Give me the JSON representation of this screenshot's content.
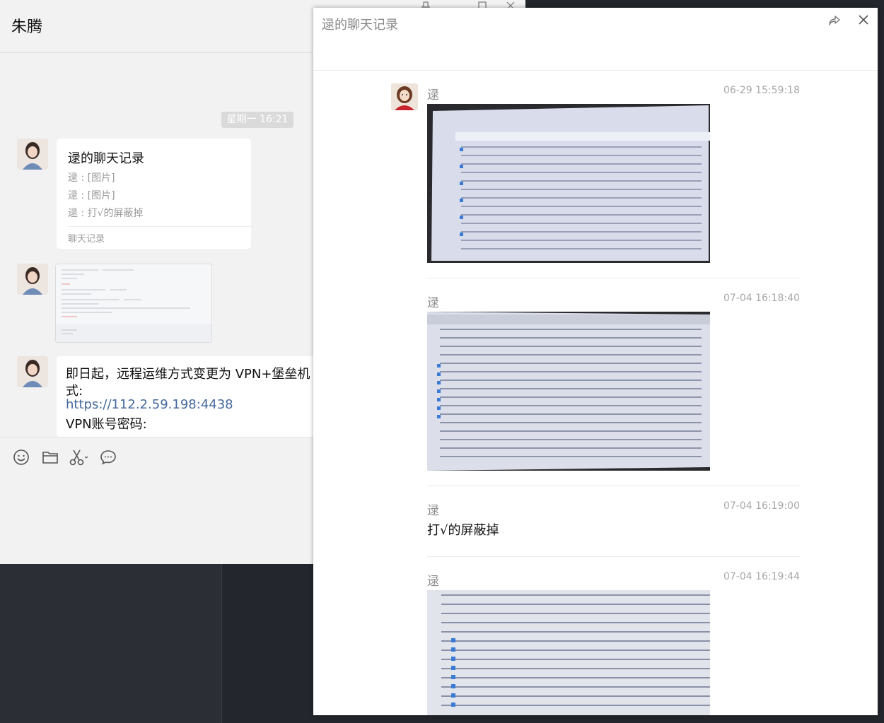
{
  "chat": {
    "title": "朱腾",
    "time_divider": "星期一 16:21",
    "forward_card": {
      "title": "逯的聊天记录",
      "lines": [
        "逯 : [图片]",
        "逯 : [图片]",
        "逯 : 打√的屏蔽掉"
      ],
      "footer": "聊天记录"
    },
    "text_message": {
      "line1": "即日起，远程运维方式变更为 VPN+堡垒机 方",
      "line2": "式:",
      "link": "https://112.2.59.198:4438",
      "line3": "VPN账号密码:"
    },
    "toolbar": [
      "emoji-icon",
      "folder-icon",
      "scissors-icon",
      "chat-bubble-icon"
    ]
  },
  "history": {
    "title": "逯的聊天记录",
    "messages": [
      {
        "sender": "逯",
        "time": "06-29 15:59:18",
        "type": "image"
      },
      {
        "sender": "逯",
        "time": "07-04 16:18:40",
        "type": "image"
      },
      {
        "sender": "逯",
        "time": "07-04 16:19:00",
        "type": "text",
        "text": "打√的屏蔽掉"
      },
      {
        "sender": "逯",
        "time": "07-04 16:19:44",
        "type": "image"
      }
    ]
  },
  "colors": {
    "link": "#44689c",
    "chat_bg": "#f2f2f2",
    "desktop_bg": "#23262c"
  }
}
